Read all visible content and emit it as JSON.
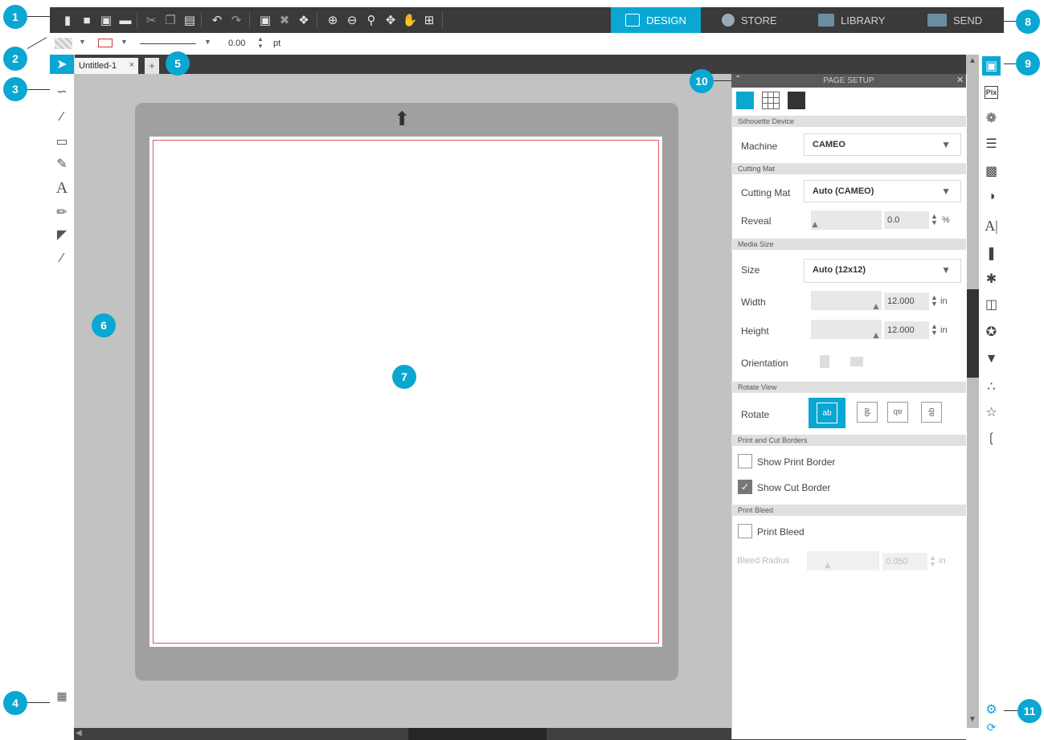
{
  "nav": {
    "design": "DESIGN",
    "store": "STORE",
    "library": "LIBRARY",
    "send": "SEND"
  },
  "properties": {
    "line_width_value": "0.00",
    "line_width_unit": "pt"
  },
  "document": {
    "tab_title": "Untitled-1",
    "close_glyph": "×",
    "add_glyph": "+"
  },
  "panel": {
    "title": "PAGE SETUP",
    "sections": {
      "device": "Silhouette Device",
      "cutting_mat": "Cutting Mat",
      "media_size": "Media Size",
      "rotate_view": "Rotate View",
      "borders": "Print and Cut Borders",
      "print_bleed": "Print Bleed"
    },
    "machine_label": "Machine",
    "machine_value": "CAMEO",
    "cutting_mat_label": "Cutting Mat",
    "cutting_mat_value": "Auto (CAMEO)",
    "reveal_label": "Reveal",
    "reveal_value": "0.0",
    "reveal_unit": "%",
    "size_label": "Size",
    "size_value": "Auto (12x12)",
    "width_label": "Width",
    "width_value": "12.000",
    "width_unit": "in",
    "height_label": "Height",
    "height_value": "12.000",
    "height_unit": "in",
    "orientation_label": "Orientation",
    "rotate_label": "Rotate",
    "rotate_options": [
      "ab",
      "ab",
      "ab",
      "ab"
    ],
    "show_print_border": "Show Print Border",
    "show_cut_border": "Show Cut Border",
    "print_bleed": "Print Bleed",
    "bleed_radius_label": "Bleed Radius",
    "bleed_radius_value": "0.050",
    "bleed_radius_unit": "in"
  },
  "right_icons": {
    "pix_label": "Pix",
    "text_label": "A|"
  },
  "left_icons": {
    "text_tool": "A"
  },
  "callouts": [
    "1",
    "2",
    "3",
    "4",
    "5",
    "6",
    "7",
    "8",
    "9",
    "10",
    "11"
  ],
  "colors": {
    "accent": "#0aa7d2",
    "toolbar": "#3a3a3a",
    "cut_border": "#e05a5a"
  }
}
